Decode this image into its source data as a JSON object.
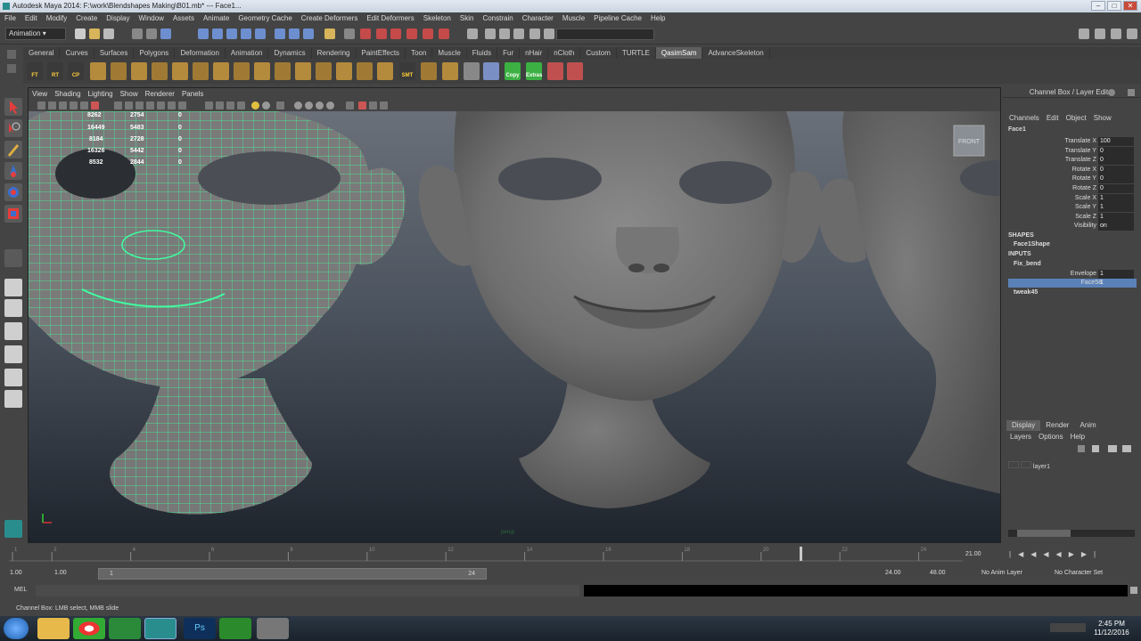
{
  "window": {
    "title": "Autodesk Maya 2014: F:\\work\\Blendshapes Making\\B01.mb* --- Face1..."
  },
  "menubar": [
    "File",
    "Edit",
    "Modify",
    "Create",
    "Display",
    "Window",
    "Assets",
    "Animate",
    "Geometry Cache",
    "Create Deformers",
    "Edit Deformers",
    "Skeleton",
    "Skin",
    "Constrain",
    "Character",
    "Muscle",
    "Pipeline Cache",
    "Help"
  ],
  "status": {
    "mode": "Animation"
  },
  "shelf": {
    "tabs": [
      "General",
      "Curves",
      "Surfaces",
      "Polygons",
      "Deformation",
      "Animation",
      "Dynamics",
      "Rendering",
      "PaintEffects",
      "Toon",
      "Muscle",
      "Fluids",
      "Fur",
      "nHair",
      "nCloth",
      "Custom",
      "TURTLE",
      "QasimSam",
      "AdvanceSkeleton"
    ],
    "active": "QasimSam",
    "icon_labels": [
      "FT",
      "RT",
      "CP",
      "SMT",
      "Copy",
      "Extras"
    ]
  },
  "viewport": {
    "menu": [
      "View",
      "Shading",
      "Lighting",
      "Show",
      "Renderer",
      "Panels"
    ],
    "hud": [
      {
        "a": "8262",
        "b": "2754",
        "c": "0"
      },
      {
        "a": "16449",
        "b": "5483",
        "c": "0"
      },
      {
        "a": "8184",
        "b": "2728",
        "c": "0"
      },
      {
        "a": "16326",
        "b": "5442",
        "c": "0"
      },
      {
        "a": "8532",
        "b": "2844",
        "c": "0"
      }
    ],
    "cam_label": "FRONT",
    "persp_label": "persp"
  },
  "channelbox": {
    "title": "Channel Box / Layer Editor",
    "menu": [
      "Channels",
      "Edit",
      "Object",
      "Show"
    ],
    "object": "Face1",
    "attributes": [
      {
        "name": "Translate X",
        "value": "100"
      },
      {
        "name": "Translate Y",
        "value": "0"
      },
      {
        "name": "Translate Z",
        "value": "0"
      },
      {
        "name": "Rotate X",
        "value": "0"
      },
      {
        "name": "Rotate Y",
        "value": "0"
      },
      {
        "name": "Rotate Z",
        "value": "0"
      },
      {
        "name": "Scale X",
        "value": "1"
      },
      {
        "name": "Scale Y",
        "value": "1"
      },
      {
        "name": "Scale Z",
        "value": "1"
      },
      {
        "name": "Visibility",
        "value": "on"
      }
    ],
    "shapes_label": "SHAPES",
    "shape": "Face1Shape",
    "inputs_label": "INPUTS",
    "input1": "Fix_bend",
    "input_attrs": [
      {
        "name": "Envelope",
        "value": "1"
      },
      {
        "name": "Face58",
        "value": "1"
      }
    ],
    "input2": "tweak45"
  },
  "layers": {
    "tabs": [
      "Display",
      "Render",
      "Anim"
    ],
    "menu": [
      "Layers",
      "Options",
      "Help"
    ],
    "layer": "layer1"
  },
  "timeline": {
    "ticks": [
      "1",
      "2",
      "4",
      "6",
      "8",
      "10",
      "12",
      "14",
      "16",
      "18",
      "20",
      "22",
      "24"
    ],
    "current": "21.00",
    "range_start": "1.00",
    "range_start2": "1.00",
    "range_slider_start": "1",
    "range_slider_end": "24",
    "range_end": "24.00",
    "range_end2": "48.00",
    "anim_layer": "No Anim Layer",
    "char_set": "No Character Set"
  },
  "cmdline": {
    "label": "MEL"
  },
  "helpline": {
    "text": "Channel Box: LMB select, MMB slide"
  },
  "taskbar": {
    "time": "2:45 PM",
    "date": "11/12/2016"
  },
  "colors": {
    "wire": "#3fffa0",
    "selection": "#5b82b8",
    "shelf_active": "#5e5e5e"
  }
}
